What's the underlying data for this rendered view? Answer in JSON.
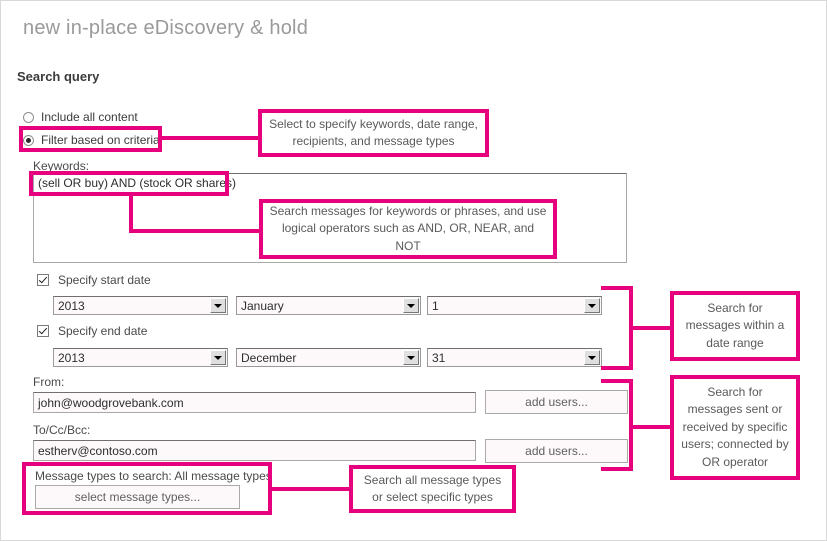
{
  "page": {
    "title": "new in-place eDiscovery & hold",
    "section_title": "Search query"
  },
  "accent_color": "#e6007e",
  "scope": {
    "options": [
      {
        "label": "Include all content",
        "selected": false
      },
      {
        "label": "Filter based on criteria",
        "selected": true
      }
    ]
  },
  "keywords": {
    "label": "Keywords:",
    "value": "(sell OR buy) AND (stock OR shares)"
  },
  "start_date": {
    "checkbox_label": "Specify start date",
    "checked": true,
    "year": "2013",
    "month": "January",
    "day": "1"
  },
  "end_date": {
    "checkbox_label": "Specify end date",
    "checked": true,
    "year": "2013",
    "month": "December",
    "day": "31"
  },
  "from": {
    "label": "From:",
    "value": "john@woodgrovebank.com",
    "button": "add users..."
  },
  "to": {
    "label": "To/Cc/Bcc:",
    "value": "estherv@contoso.com",
    "button": "add users..."
  },
  "message_types": {
    "label": "Message types to search:  All message types",
    "button": "select message types..."
  },
  "callouts": [
    {
      "id": "scope",
      "text": "Select to specify keywords, date range, recipients, and message types"
    },
    {
      "id": "keywords",
      "text": "Search messages for keywords or phrases, and use logical operators such as AND, OR, NEAR, and NOT"
    },
    {
      "id": "dates",
      "text": "Search for messages within a date range"
    },
    {
      "id": "users",
      "text": "Search for messages sent or received by specific users; connected by OR operator"
    },
    {
      "id": "message-types",
      "text": "Search all message types or select specific types"
    }
  ]
}
